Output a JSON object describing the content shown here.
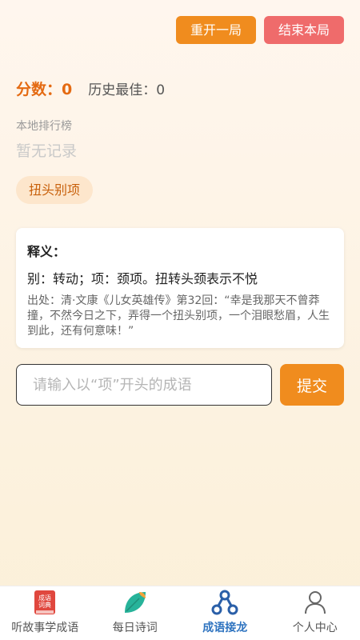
{
  "header": {
    "restart_label": "重开一局",
    "end_label": "结束本局"
  },
  "score": {
    "label": "分数：",
    "value": "0",
    "best_label": "历史最佳：",
    "best_value": "0"
  },
  "ranking": {
    "title": "本地排行榜",
    "empty_text": "暂无记录"
  },
  "current_idiom": "扭头别项",
  "card": {
    "title": "释义：",
    "meaning": "别：转动；项：颈项。扭转头颈表示不悦",
    "source": "出处：清·文康《儿女英雄传》第32回：“幸是我那天不曾莽撞，不然今日之下，弄得一个扭头别项，一个泪眼愁眉，人生到此，还有何意味！”"
  },
  "input": {
    "placeholder": "请输入以“项”开头的成语",
    "value": "",
    "submit_label": "提交"
  },
  "tabs": [
    {
      "label": "听故事学成语",
      "icon": "dictionary-book-icon",
      "active": false
    },
    {
      "label": "每日诗词",
      "icon": "leaf-icon",
      "active": false
    },
    {
      "label": "成语接龙",
      "icon": "chain-nodes-icon",
      "active": true
    },
    {
      "label": "个人中心",
      "icon": "user-icon",
      "active": false
    }
  ],
  "icon_text": "成语词典",
  "colors": {
    "accent": "#f08c1e",
    "danger": "#ef6b6b",
    "score": "#e46a12",
    "active_tab": "#2f74c0"
  }
}
